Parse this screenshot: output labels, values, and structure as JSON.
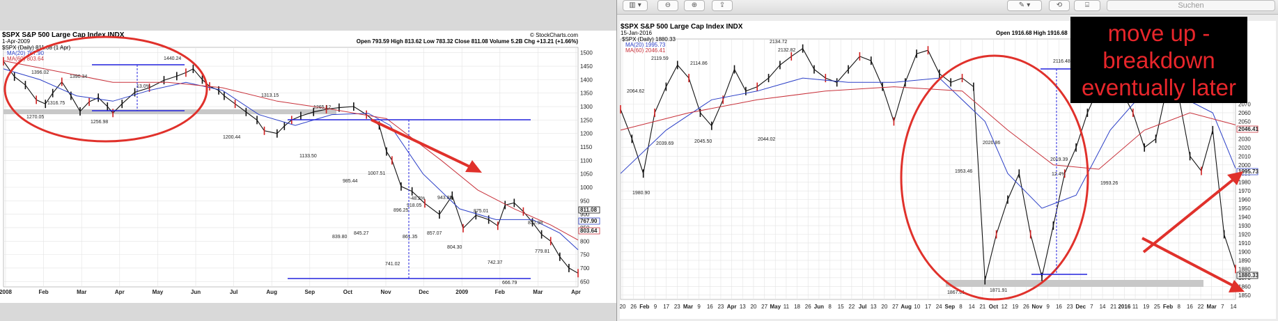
{
  "toolbar": {
    "search_placeholder": "Suchen"
  },
  "callout": {
    "lines": [
      "move up -",
      "breakdown",
      "eventually later"
    ]
  },
  "chart_data": [
    {
      "type": "line",
      "title": "$SPX S&P 500 Large Cap Index INDX",
      "date": "1-Apr-2009",
      "source": "© StockCharts.com",
      "ohlc": "Open 793.59 High 813.62 Low 783.32 Close 811.08 Volume 5.2B Chg +13.21 (+1.66%)",
      "legend": [
        "$SPX (Daily) 811.08 (1 Apr)",
        "MA(20) 767.90",
        "MA(60) 803.64"
      ],
      "x_tick_labels": [
        "2008",
        "Feb",
        "Mar",
        "Apr",
        "May",
        "Jun",
        "Jul",
        "Aug",
        "Sep",
        "Oct",
        "Nov",
        "Dec",
        "2009",
        "Feb",
        "Mar",
        "Apr"
      ],
      "y_tick_labels": [
        1500,
        1450,
        1400,
        1350,
        1300,
        1250,
        1200,
        1150,
        1100,
        1050,
        1000,
        950,
        900,
        850,
        800,
        750,
        700,
        650
      ],
      "ylim": [
        630,
        1520
      ],
      "last_price_labels": [
        "811.08",
        "767.90",
        "803.64"
      ],
      "series": [
        {
          "name": "$SPX",
          "x": [
            0,
            6,
            12,
            18,
            23,
            27,
            32,
            37,
            42,
            47,
            52,
            57,
            60,
            65,
            72,
            80,
            88,
            95,
            100,
            104,
            109,
            113,
            118,
            121,
            127,
            133,
            139,
            143,
            150,
            154,
            158,
            163,
            170,
            177,
            184,
            192,
            199,
            206,
            210,
            213,
            218,
            224,
            231,
            239,
            246,
            252,
            259,
            266,
            271,
            275,
            280,
            285,
            290,
            295,
            300,
            305,
            310,
            315
          ],
          "values": [
            1468,
            1411,
            1380,
            1325,
            1310,
            1350,
            1392,
            1340,
            1282,
            1318,
            1333,
            1300,
            1276,
            1310,
            1353,
            1370,
            1398,
            1413,
            1426,
            1440,
            1400,
            1375,
            1360,
            1340,
            1310,
            1280,
            1250,
            1210,
            1200,
            1228,
            1250,
            1265,
            1280,
            1290,
            1296,
            1300,
            1270,
            1230,
            1133,
            1100,
            1003,
            985,
            940,
            899,
            969,
            848,
            896,
            880,
            857,
            934,
            942,
            910,
            870,
            825,
            800,
            742,
            700,
            681
          ]
        },
        {
          "name": "MA(20)",
          "x": [
            0,
            20,
            40,
            60,
            80,
            100,
            120,
            140,
            160,
            180,
            200,
            212,
            230,
            250,
            270,
            290,
            305,
            315
          ],
          "values": [
            1440,
            1400,
            1340,
            1320,
            1360,
            1390,
            1360,
            1270,
            1230,
            1270,
            1275,
            1230,
            1050,
            920,
            880,
            880,
            830,
            768
          ]
        },
        {
          "name": "MA(60)",
          "x": [
            0,
            30,
            60,
            90,
            120,
            150,
            180,
            210,
            240,
            260,
            280,
            300,
            315
          ],
          "values": [
            1470,
            1430,
            1390,
            1390,
            1370,
            1320,
            1290,
            1255,
            1100,
            990,
            920,
            860,
            804
          ]
        }
      ],
      "annotations": [
        "1396.02",
        "1390.34",
        "1440.24",
        "13.0%",
        "1316.75",
        "1270.05",
        "1256.98",
        "1313.15",
        "1265.12",
        "1200.44",
        "1133.50",
        "1007.51",
        "985.44",
        "839.80",
        "845.27",
        "896.25",
        "918.05",
        "943.85",
        "-48.2%",
        "861.35",
        "857.07",
        "741.02",
        "804.30",
        "875.01",
        "832.98",
        "742.37",
        "666.79",
        "779.81"
      ]
    },
    {
      "type": "line",
      "title": "$SPX S&P 500 Large Cap Index INDX",
      "date": "15-Jan-2016",
      "ohlc": "Open 1916.68 High 1916.68",
      "legend": [
        "$SPX (Daily) 1880.33",
        "MA(20) 1995.73",
        "MA(60) 2046.41"
      ],
      "x_tick_labels": [
        "20",
        "26",
        "Feb",
        "9",
        "17",
        "23",
        "Mar",
        "9",
        "16",
        "23",
        "Apr",
        "13",
        "20",
        "27",
        "May",
        "11",
        "18",
        "26",
        "Jun",
        "8",
        "15",
        "22",
        "Jul",
        "13",
        "20",
        "27",
        "Aug",
        "10",
        "17",
        "24",
        "Sep",
        "8",
        "14",
        "21",
        "Oct",
        "12",
        "19",
        "26",
        "Nov",
        "9",
        "16",
        "23",
        "Dec",
        "7",
        "14",
        "21",
        "2016",
        "11",
        "19",
        "25",
        "Feb",
        "8",
        "16",
        "22",
        "Mar",
        "7",
        "14"
      ],
      "y_tick_labels": [
        2070,
        2060,
        2050,
        2040,
        2030,
        2020,
        2010,
        2000,
        1990,
        1980,
        1970,
        1960,
        1950,
        1940,
        1930,
        1920,
        1910,
        1900,
        1890,
        1880,
        1870,
        1860,
        1850
      ],
      "ylim": [
        1845,
        2145
      ],
      "last_price_labels": [
        "2046.41",
        "1995.73",
        "1880.33"
      ],
      "series": [
        {
          "name": "$SPX",
          "x": [
            0,
            5,
            10,
            15,
            20,
            25,
            30,
            35,
            40,
            45,
            50,
            55,
            60,
            65,
            70,
            75,
            80,
            85,
            90,
            95,
            100,
            105,
            110,
            115,
            120,
            125,
            130,
            135,
            140,
            145,
            150,
            155,
            160,
            165,
            170,
            175,
            180,
            185,
            190,
            195,
            200,
            205,
            210,
            215,
            220,
            225,
            230,
            235,
            240,
            245,
            250,
            255,
            260,
            265,
            270
          ],
          "values": [
            2064,
            2030,
            1990,
            2060,
            2090,
            2115,
            2100,
            2060,
            2045,
            2075,
            2110,
            2085,
            2090,
            2100,
            2115,
            2125,
            2134,
            2110,
            2100,
            2095,
            2110,
            2125,
            2120,
            2090,
            2050,
            2095,
            2128,
            2132,
            2105,
            2095,
            2100,
            2090,
            1867,
            1920,
            1960,
            1990,
            1920,
            1871,
            1930,
            1990,
            2020,
            2060,
            2090,
            2116,
            2085,
            2060,
            2020,
            2030,
            2090,
            2080,
            2010,
            1993,
            2040,
            1920,
            1880
          ]
        },
        {
          "name": "MA(20)",
          "x": [
            0,
            20,
            40,
            60,
            80,
            100,
            120,
            140,
            160,
            170,
            185,
            200,
            215,
            230,
            245,
            260,
            270
          ],
          "values": [
            1990,
            2040,
            2075,
            2085,
            2100,
            2095,
            2095,
            2100,
            2050,
            1990,
            1950,
            1965,
            2040,
            2085,
            2080,
            2060,
            1996
          ]
        },
        {
          "name": "MA(60)",
          "x": [
            0,
            30,
            60,
            90,
            120,
            150,
            170,
            190,
            210,
            230,
            250,
            270
          ],
          "values": [
            2040,
            2060,
            2075,
            2085,
            2090,
            2085,
            2040,
            2000,
            1995,
            2040,
            2060,
            2046
          ]
        }
      ],
      "annotations": [
        "2064.62",
        "2119.59",
        "2114.86",
        "2134.72",
        "2132.82",
        "1980.90",
        "2039.69",
        "2045.50",
        "2044.02",
        "1867.01",
        "1871.91",
        "2020.86",
        "1953.46",
        "2116.48",
        "12.4%",
        "2019.39",
        "1993.26"
      ]
    }
  ]
}
